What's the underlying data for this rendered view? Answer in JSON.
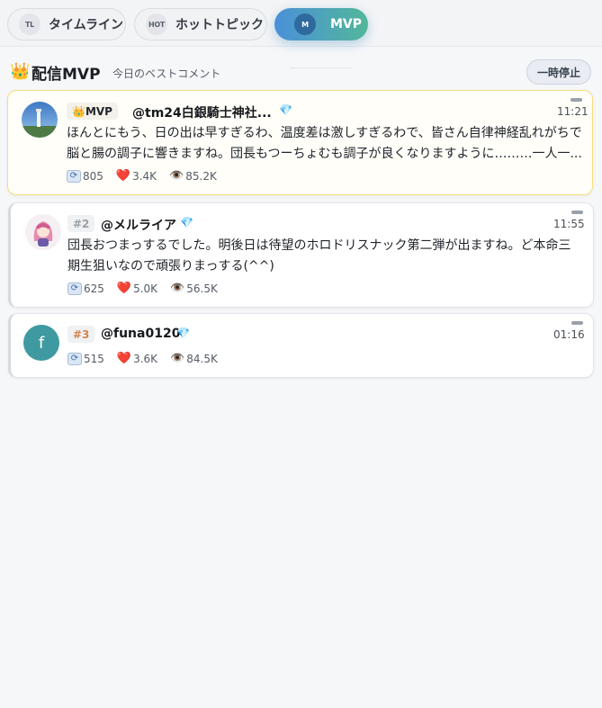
{
  "tabs": [
    {
      "badge": "TL",
      "label": "タイムライン"
    },
    {
      "badge": "HOT",
      "label": "ホットトピック"
    },
    {
      "badge": "M",
      "label": "MVP"
    }
  ],
  "header": {
    "crown_icon": "👑",
    "title": "配信MVP",
    "subtitle": "今日のベストコメント",
    "pause_label": "一時停止"
  },
  "icons": {
    "retweet": "retweet-icon",
    "like": "❤️",
    "view": "👁️",
    "diamond": "💎"
  },
  "comments": [
    {
      "rank": "MVP",
      "rank_icon": "👑",
      "user": "@tm24白銀騎士神社...",
      "time": "11:21",
      "text_line1": "ほんとにもう、日の出は早すぎるわ、温度差は激しすぎるわで、皆さん自律神経乱れがちで",
      "text_line2": "脳と腸の調子に響きますね。団長もつーちょむも調子が良くなりますように………一人一...",
      "retweets": "805",
      "likes": "3.4K",
      "views": "85.2K"
    },
    {
      "rank": "#2",
      "user": "@メルライア",
      "time": "11:55",
      "text_line1": "団長おつまっするでした。明後日は待望のホロドリスナック第二弾が出ますね。ど本命三",
      "text_line2": "期生狙いなので頑張りまっする(^^)",
      "retweets": "625",
      "likes": "5.0K",
      "views": "56.5K"
    },
    {
      "rank": "#3",
      "user": "@funa0120",
      "avatar_letter": "f",
      "time": "01:16",
      "retweets": "515",
      "likes": "3.6K",
      "views": "84.5K"
    }
  ],
  "colors": {
    "accent_start": "#4a90d9",
    "accent_end": "#52b79a",
    "mvp_border": "#f2df7a",
    "avatar3_bg": "#3e9aa0"
  }
}
